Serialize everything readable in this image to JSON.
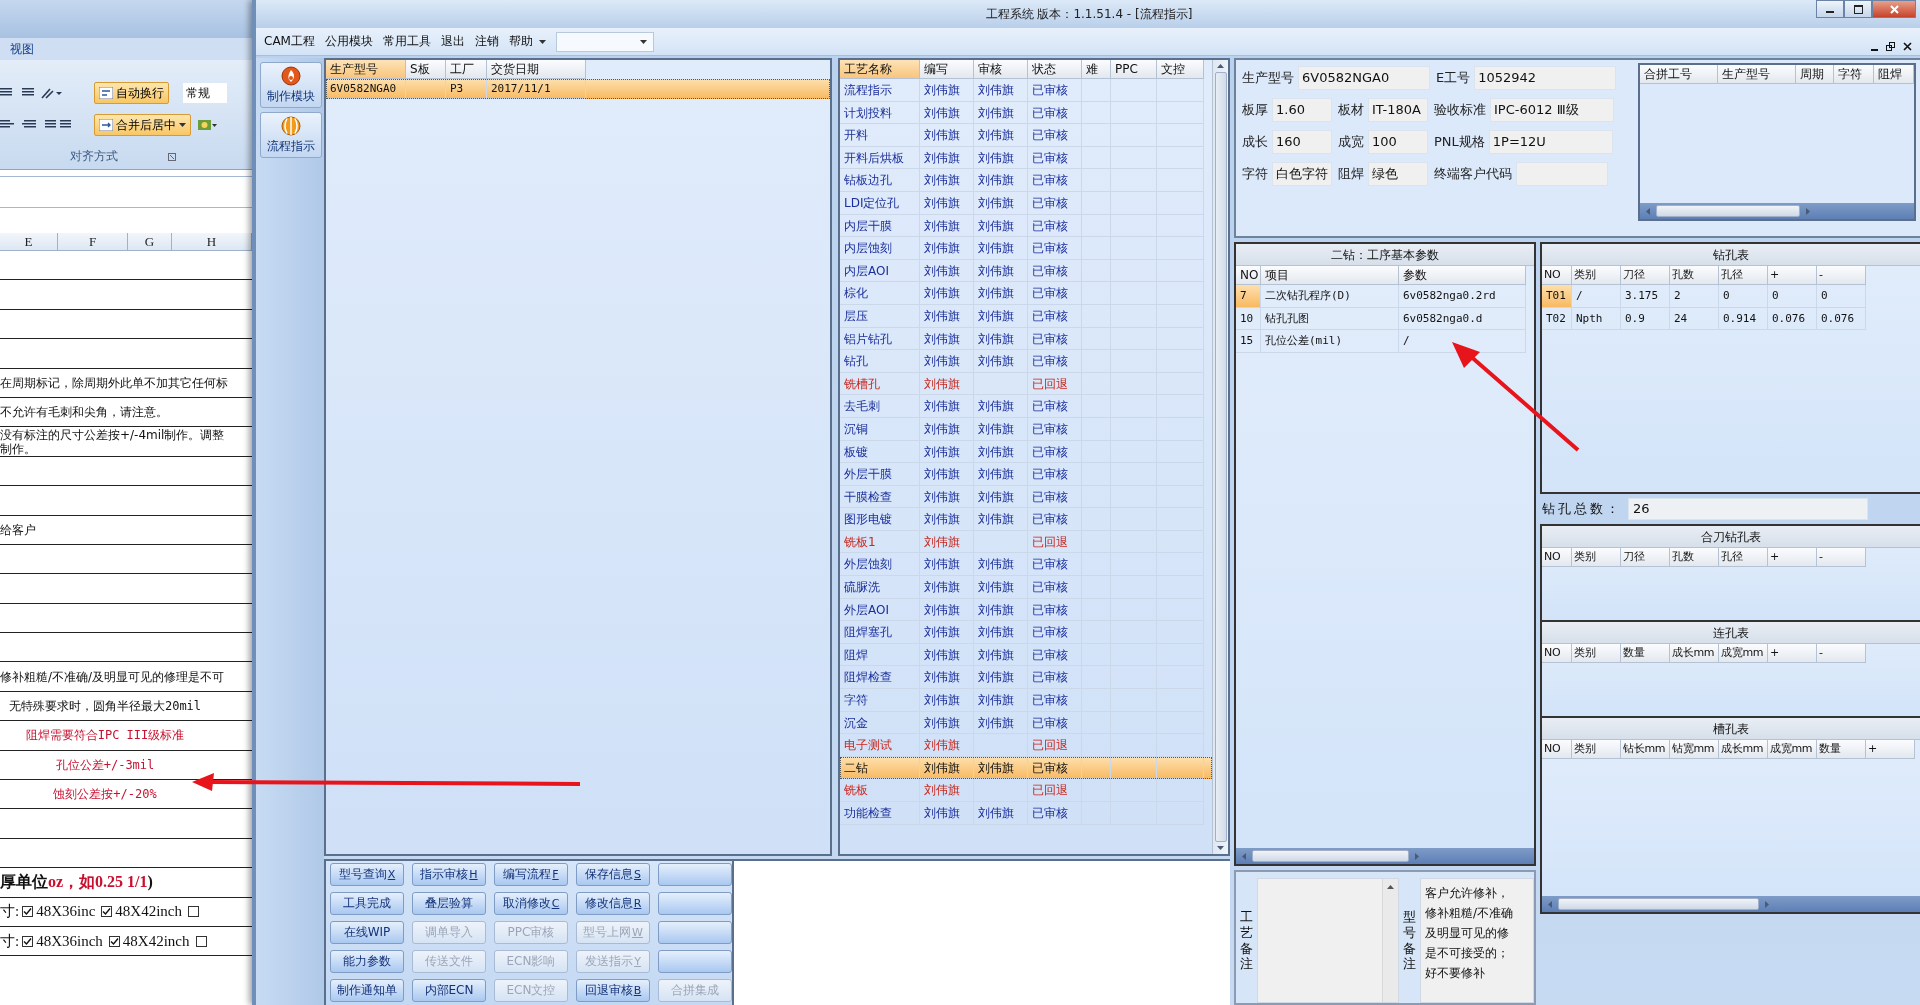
{
  "excel": {
    "tab": "视图",
    "wrap_button": "自动换行",
    "merge_button": "合并后居中",
    "number_format": "常规",
    "group_label": "对齐方式",
    "columns": [
      "E",
      "F",
      "G",
      "H"
    ],
    "rows": [
      {
        "kind": "blank"
      },
      {
        "kind": "blank"
      },
      {
        "kind": "blank"
      },
      {
        "kind": "blank"
      },
      {
        "kind": "text",
        "text": "在周期标记，除周期外此单不加其它任何标"
      },
      {
        "kind": "text",
        "text": "不允许有毛刺和尖角，请注意。"
      },
      {
        "kind": "text",
        "text": "没有标注的尺寸公差按+/-4mil制作。调整制作。"
      },
      {
        "kind": "blank"
      },
      {
        "kind": "blank"
      },
      {
        "kind": "text",
        "text": "给客户"
      },
      {
        "kind": "blank"
      },
      {
        "kind": "blank"
      },
      {
        "kind": "blank"
      },
      {
        "kind": "blank"
      },
      {
        "kind": "text",
        "text": "修补粗糙/不准确/及明显可见的修理是不可"
      },
      {
        "kind": "centered",
        "text": "无特殊要求时，圆角半径最大20mil"
      },
      {
        "kind": "centered",
        "text": "阻焊需要符合IPC III级标准",
        "color": "#c8102e"
      },
      {
        "kind": "centered",
        "text": "孔位公差+/-3mil",
        "color": "#c8102e"
      },
      {
        "kind": "centered",
        "text": "蚀刻公差按+/-20%",
        "color": "#c8102e"
      },
      {
        "kind": "blank"
      },
      {
        "kind": "blank"
      },
      {
        "kind": "mixed",
        "parts": [
          {
            "text": "厚单位"
          },
          {
            "text": "oz，如0.25 1/1",
            "color": "#c8102e"
          },
          {
            "text": ")"
          }
        ]
      },
      {
        "kind": "checks",
        "label": "寸:",
        "options": [
          {
            "text": "48X36inc",
            "checked": true
          },
          {
            "text": "48X42inch",
            "checked": true
          },
          {
            "checked": false
          }
        ]
      },
      {
        "kind": "checks",
        "label": "寸:",
        "options": [
          {
            "text": "48X36inch",
            "checked": true
          },
          {
            "text": "48X42inch",
            "checked": true
          },
          {
            "checked": false
          }
        ]
      }
    ]
  },
  "window": {
    "title": "工程系统  版本：1.1.51.4 - [流程指示]"
  },
  "menu": [
    "CAM工程",
    "公用模块",
    "常用工具",
    "退出",
    "注销",
    "帮助"
  ],
  "nav": [
    "制作模块",
    "流程指示"
  ],
  "orders": {
    "columns": [
      {
        "label": "生产型号",
        "sorted": true
      },
      {
        "label": "S板",
        "sorted": false
      },
      {
        "label": "工厂",
        "sorted": false
      },
      {
        "label": "交货日期",
        "sorted": false
      }
    ],
    "rows": [
      {
        "cells": [
          "6V0582NGA0",
          null,
          "P3",
          "2017/11/1"
        ],
        "selected": true
      }
    ]
  },
  "process": {
    "columns": [
      {
        "label": "工艺名称",
        "sorted": true
      },
      {
        "label": "编写",
        "sorted": false
      },
      {
        "label": "审核",
        "sorted": false
      },
      {
        "label": "状态",
        "sorted": false
      },
      {
        "label": "难",
        "sorted": false
      },
      {
        "label": "PPC",
        "sorted": false
      },
      {
        "label": "文控",
        "sorted": false
      }
    ],
    "rows": [
      {
        "name": "流程指示",
        "writer": "刘伟旗",
        "reviewer": "刘伟旗",
        "status": "已审核",
        "returned": false,
        "selected": false
      },
      {
        "name": "计划投料",
        "writer": "刘伟旗",
        "reviewer": "刘伟旗",
        "status": "已审核",
        "returned": false,
        "selected": false
      },
      {
        "name": "开料",
        "writer": "刘伟旗",
        "reviewer": "刘伟旗",
        "status": "已审核",
        "returned": false,
        "selected": false
      },
      {
        "name": "开料后烘板",
        "writer": "刘伟旗",
        "reviewer": "刘伟旗",
        "status": "已审核",
        "returned": false,
        "selected": false
      },
      {
        "name": "钻板边孔",
        "writer": "刘伟旗",
        "reviewer": "刘伟旗",
        "status": "已审核",
        "returned": false,
        "selected": false
      },
      {
        "name": "LDI定位孔",
        "writer": "刘伟旗",
        "reviewer": "刘伟旗",
        "status": "已审核",
        "returned": false,
        "selected": false
      },
      {
        "name": "内层干膜",
        "writer": "刘伟旗",
        "reviewer": "刘伟旗",
        "status": "已审核",
        "returned": false,
        "selected": false
      },
      {
        "name": "内层蚀刻",
        "writer": "刘伟旗",
        "reviewer": "刘伟旗",
        "status": "已审核",
        "returned": false,
        "selected": false
      },
      {
        "name": "内层AOI",
        "writer": "刘伟旗",
        "reviewer": "刘伟旗",
        "status": "已审核",
        "returned": false,
        "selected": false
      },
      {
        "name": "棕化",
        "writer": "刘伟旗",
        "reviewer": "刘伟旗",
        "status": "已审核",
        "returned": false,
        "selected": false
      },
      {
        "name": "层压",
        "writer": "刘伟旗",
        "reviewer": "刘伟旗",
        "status": "已审核",
        "returned": false,
        "selected": false
      },
      {
        "name": "铝片钻孔",
        "writer": "刘伟旗",
        "reviewer": "刘伟旗",
        "status": "已审核",
        "returned": false,
        "selected": false
      },
      {
        "name": "钻孔",
        "writer": "刘伟旗",
        "reviewer": "刘伟旗",
        "status": "已审核",
        "returned": false,
        "selected": false
      },
      {
        "name": "铣槽孔",
        "writer": "刘伟旗",
        "status": "已回退",
        "returned": true,
        "selected": false
      },
      {
        "name": "去毛刺",
        "writer": "刘伟旗",
        "reviewer": "刘伟旗",
        "status": "已审核",
        "returned": false,
        "selected": false
      },
      {
        "name": "沉铜",
        "writer": "刘伟旗",
        "reviewer": "刘伟旗",
        "status": "已审核",
        "returned": false,
        "selected": false
      },
      {
        "name": "板镀",
        "writer": "刘伟旗",
        "reviewer": "刘伟旗",
        "status": "已审核",
        "returned": false,
        "selected": false
      },
      {
        "name": "外层干膜",
        "writer": "刘伟旗",
        "reviewer": "刘伟旗",
        "status": "已审核",
        "returned": false,
        "selected": false
      },
      {
        "name": "干膜检查",
        "writer": "刘伟旗",
        "reviewer": "刘伟旗",
        "status": "已审核",
        "returned": false,
        "selected": false
      },
      {
        "name": "图形电镀",
        "writer": "刘伟旗",
        "reviewer": "刘伟旗",
        "status": "已审核",
        "returned": false,
        "selected": false
      },
      {
        "name": "铣板1",
        "writer": "刘伟旗",
        "status": "已回退",
        "returned": true,
        "selected": false
      },
      {
        "name": "外层蚀刻",
        "writer": "刘伟旗",
        "reviewer": "刘伟旗",
        "status": "已审核",
        "returned": false,
        "selected": false
      },
      {
        "name": "硫脲洗",
        "writer": "刘伟旗",
        "reviewer": "刘伟旗",
        "status": "已审核",
        "returned": false,
        "selected": false
      },
      {
        "name": "外层AOI",
        "writer": "刘伟旗",
        "reviewer": "刘伟旗",
        "status": "已审核",
        "returned": false,
        "selected": false
      },
      {
        "name": "阻焊塞孔",
        "writer": "刘伟旗",
        "reviewer": "刘伟旗",
        "status": "已审核",
        "returned": false,
        "selected": false
      },
      {
        "name": "阻焊",
        "writer": "刘伟旗",
        "reviewer": "刘伟旗",
        "status": "已审核",
        "returned": false,
        "selected": false
      },
      {
        "name": "阻焊检查",
        "writer": "刘伟旗",
        "reviewer": "刘伟旗",
        "status": "已审核",
        "returned": false,
        "selected": false
      },
      {
        "name": "字符",
        "writer": "刘伟旗",
        "reviewer": "刘伟旗",
        "status": "已审核",
        "returned": false,
        "selected": false
      },
      {
        "name": "沉金",
        "writer": "刘伟旗",
        "reviewer": "刘伟旗",
        "status": "已审核",
        "returned": false,
        "selected": false
      },
      {
        "name": "电子测试",
        "writer": "刘伟旗",
        "status": "已回退",
        "returned": true,
        "selected": false
      },
      {
        "name": "二钻",
        "writer": "刘伟旗",
        "reviewer": "刘伟旗",
        "status": "已审核",
        "returned": false,
        "selected": true
      },
      {
        "name": "铣板",
        "writer": "刘伟旗",
        "status": "已回退",
        "returned": true,
        "selected": false
      },
      {
        "name": "功能检查",
        "writer": "刘伟旗",
        "reviewer": "刘伟旗",
        "status": "已审核",
        "returned": false,
        "selected": false
      }
    ]
  },
  "buttons": [
    {
      "label": "型号查询",
      "key": "X",
      "disabled": false
    },
    {
      "label": "指示审核",
      "key": "H",
      "disabled": false
    },
    {
      "label": "编写流程",
      "key": "F",
      "disabled": false
    },
    {
      "label": "保存信息",
      "key": "S",
      "disabled": false
    },
    {
      "disabled": false
    },
    {
      "label": "工具完成",
      "disabled": false
    },
    {
      "label": "叠层验算",
      "disabled": false
    },
    {
      "label": "取消修改",
      "key": "C",
      "disabled": false
    },
    {
      "label": "修改信息",
      "key": "R",
      "disabled": false
    },
    {
      "disabled": false
    },
    {
      "label": "在线WIP",
      "disabled": false
    },
    {
      "label": "调单导入",
      "disabled": true
    },
    {
      "label": "PPC审核",
      "disabled": true
    },
    {
      "label": "型号上网",
      "key": "W",
      "disabled": true
    },
    {
      "disabled": false
    },
    {
      "label": "能力参数",
      "disabled": false
    },
    {
      "label": "传送文件",
      "disabled": true
    },
    {
      "label": "ECN影响",
      "disabled": true
    },
    {
      "label": "发送指示",
      "key": "Y",
      "disabled": true
    },
    {
      "disabled": false
    },
    {
      "label": "制作通知单",
      "disabled": false
    },
    {
      "label": "内部ECN",
      "disabled": false
    },
    {
      "label": "ECN文控",
      "disabled": true
    },
    {
      "label": "回退审核",
      "key": "B",
      "disabled": false
    },
    {
      "label": "合拼集成",
      "disabled": true
    }
  ],
  "info": {
    "fields": [
      {
        "label": "生产型号",
        "value": "6V0582NGA0"
      },
      {
        "label": "E工号",
        "value": "1052942"
      },
      {
        "label": "板厚",
        "value": "1.60"
      },
      {
        "label": "板材",
        "value": "IT-180A"
      },
      {
        "label": "验收标准",
        "value": "IPC-6012 Ⅲ级"
      },
      {
        "label": "成长",
        "value": "160"
      },
      {
        "label": "成宽",
        "value": "100"
      },
      {
        "label": "PNL规格",
        "value": "1P=12U"
      },
      {
        "label": "字符",
        "value": "白色字符"
      },
      {
        "label": "阻焊",
        "value": "绿色"
      },
      {
        "label": "终端客户代码"
      }
    ]
  },
  "merge_grid": {
    "columns": [
      "合拼工号",
      "生产型号",
      "周期",
      "字符",
      "阻焊"
    ]
  },
  "params": {
    "title": "二钻：工序基本参数",
    "columns": [
      "NO",
      "项目",
      "参数"
    ],
    "rows": [
      {
        "cells": [
          "7",
          "二次钻孔程序(D)",
          "6v0582nga0.2rd"
        ],
        "selected": true
      },
      {
        "cells": [
          "10",
          "钻孔孔图",
          "6v0582nga0.d"
        ],
        "selected": false
      },
      {
        "cells": [
          "15",
          "孔位公差(mil)",
          "/"
        ],
        "selected": false
      }
    ]
  },
  "drill_tables": [
    {
      "title": "钻孔表",
      "columns": [
        "NO",
        "类别",
        "刀径",
        "孔数",
        "孔径",
        "+",
        "-"
      ],
      "rows": [
        {
          "cells": [
            "T01",
            "/",
            "3.175",
            "2",
            "0",
            "0",
            "0"
          ],
          "selected": true
        },
        {
          "cells": [
            "T02",
            "Npth",
            "0.9",
            "24",
            "0.914",
            "0.076",
            "0.076"
          ],
          "selected": false
        }
      ]
    },
    {
      "title": "合刀钻孔表",
      "columns": [
        "NO",
        "类别",
        "刀径",
        "孔数",
        "孔径",
        "+",
        "-"
      ]
    },
    {
      "title": "连孔表",
      "columns": [
        "NO",
        "类别",
        "数量",
        "成长mm",
        "成宽mm",
        "+",
        "-"
      ]
    },
    {
      "title": "槽孔表",
      "columns": [
        "NO",
        "类别",
        "钻长mm",
        "钻宽mm",
        "成长mm",
        "成宽mm",
        "数量",
        "+"
      ]
    }
  ],
  "total_holes": {
    "label": "钻孔总数：",
    "value": "26"
  },
  "notes": {
    "process_label": "工艺备注",
    "model_label": "型号备注",
    "model_lines": [
      "客户允许修补，",
      "修补粗糙/不准确",
      "及明显可见的修",
      "是不可接受的；",
      "好不要修补"
    ]
  }
}
